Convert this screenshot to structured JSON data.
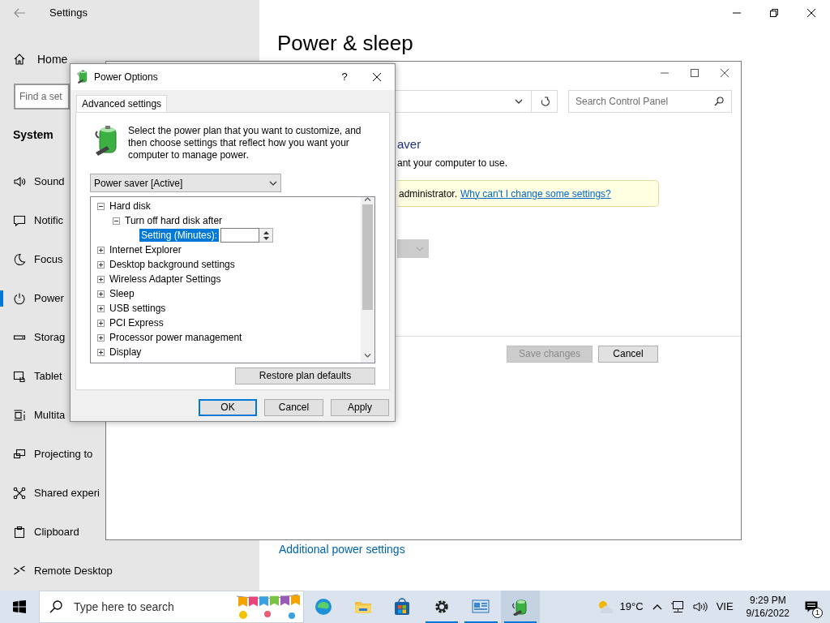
{
  "settings_window": {
    "title": "Settings",
    "heading": "Power & sleep",
    "sidebar": {
      "home": "Home",
      "search_placeholder": "Find a set",
      "section": "System",
      "items": [
        {
          "label": "Sound",
          "selected": false
        },
        {
          "label": "Notific",
          "selected": false
        },
        {
          "label": "Focus",
          "selected": false
        },
        {
          "label": "Power",
          "selected": true
        },
        {
          "label": "Storag",
          "selected": false
        },
        {
          "label": "Tablet",
          "selected": false
        },
        {
          "label": "Multita",
          "selected": false
        },
        {
          "label": "Projecting to",
          "selected": false
        },
        {
          "label": "Shared experi",
          "selected": false
        },
        {
          "label": "Clipboard",
          "selected": false
        },
        {
          "label": "Remote Desktop",
          "selected": false
        }
      ]
    },
    "link": "Additional power settings"
  },
  "control_panel_window": {
    "search_placeholder": "Search Control Panel",
    "heading": "aver",
    "subtitle": "ant your computer to use.",
    "notice": "administrator.",
    "notice_link": "Why can't I change some settings?",
    "buttons": [
      {
        "label": "Save changes",
        "disabled": true
      },
      {
        "label": "Cancel",
        "disabled": false
      }
    ]
  },
  "power_options_dialog": {
    "title": "Power Options",
    "help": "?",
    "tabs": [
      {
        "label": "Advanced settings",
        "selected": true
      }
    ],
    "description": "Select the power plan that you want to customize, and then choose settings that reflect how you want your computer to manage power.",
    "plan": "Power saver [Active]",
    "tree": [
      {
        "label": "Hard disk",
        "expanded": true,
        "children": [
          {
            "label": "Turn off hard disk after",
            "expanded": true,
            "children": [
              {
                "label": "Setting (Minutes):",
                "kind": "setting",
                "selected": true
              }
            ]
          }
        ]
      },
      {
        "label": "Internet Explorer",
        "expanded": false
      },
      {
        "label": "Desktop background settings",
        "expanded": false
      },
      {
        "label": "Wireless Adapter Settings",
        "expanded": false
      },
      {
        "label": "Sleep",
        "expanded": false
      },
      {
        "label": "USB settings",
        "expanded": false
      },
      {
        "label": "PCI Express",
        "expanded": false
      },
      {
        "label": "Processor power management",
        "expanded": false
      },
      {
        "label": "Display",
        "expanded": false
      }
    ],
    "restore_button": "Restore plan defaults",
    "buttons": [
      {
        "label": "OK",
        "default": true
      },
      {
        "label": "Cancel",
        "default": false
      },
      {
        "label": "Apply",
        "default": false
      }
    ]
  },
  "taskbar": {
    "search_placeholder": "Type here to search",
    "apps": [
      {
        "running": false,
        "selected": false
      },
      {
        "running": false,
        "selected": false
      },
      {
        "running": false,
        "selected": false
      },
      {
        "running": true,
        "selected": false
      },
      {
        "running": true,
        "selected": false
      },
      {
        "running": true,
        "selected": true
      }
    ],
    "temperature": "19°C",
    "language": "VIE",
    "time": "9:29 PM",
    "date": "9/16/2022",
    "notification_count": "1"
  }
}
